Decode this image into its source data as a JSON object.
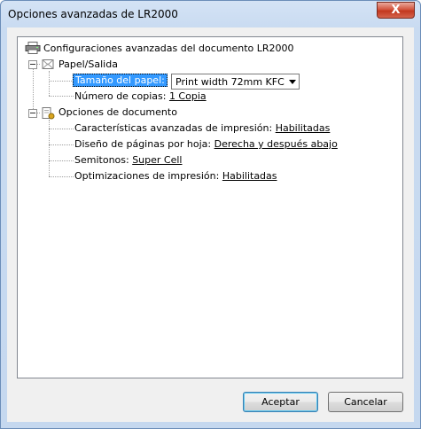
{
  "window": {
    "title": "Opciones avanzadas de LR2000",
    "close_symbol": "X"
  },
  "tree": {
    "root": {
      "label": "Configuraciones avanzadas del documento LR2000",
      "icon": "printer-icon"
    },
    "paper": {
      "label": "Papel/Salida",
      "icon": "paper-output-icon",
      "size_label": "Tamaño del papel:",
      "size_value": "Print width 72mm KFC",
      "copies_label": "Número de copias:",
      "copies_value": "1 Copia"
    },
    "document": {
      "label": "Opciones de documento",
      "icon": "document-options-icon",
      "items": [
        {
          "label": "Características avanzadas de impresión:",
          "value": "Habilitadas"
        },
        {
          "label": "Diseño de páginas por hoja:",
          "value": "Derecha y después abajo"
        },
        {
          "label": "Semitonos:",
          "value": "Super Cell"
        },
        {
          "label": "Optimizaciones de impresión:",
          "value": "Habilitadas"
        }
      ]
    }
  },
  "buttons": {
    "accept": "Aceptar",
    "cancel": "Cancelar"
  },
  "colors": {
    "selection": "#3399ff",
    "title_bar": "#c9dbf1",
    "close": "#c2381f"
  }
}
